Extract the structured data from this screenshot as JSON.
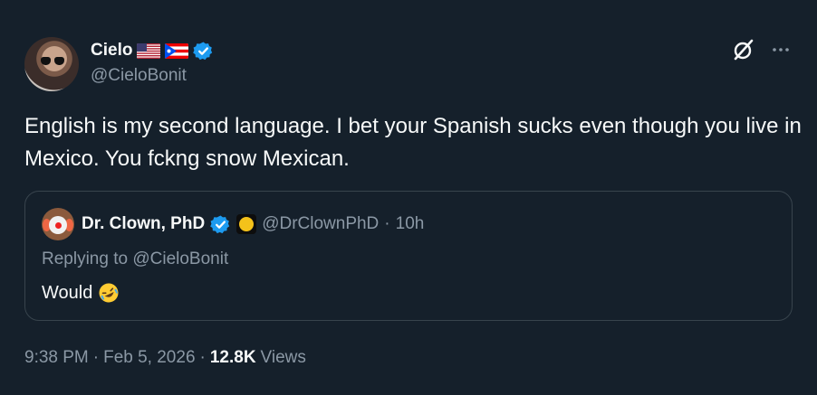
{
  "author": {
    "name": "Cielo",
    "handle": "@CieloBonit"
  },
  "tweet": {
    "text": "English is my second language. I bet your Spanish sucks even though you live in Mexico. You fckng snow Mexican."
  },
  "quoted_tweet": {
    "name": "Dr. Clown, PhD",
    "handle": "@DrClownPhD",
    "separator": "·",
    "time": "10h",
    "replying_prefix": "Replying to",
    "replying_handle": "@CieloBonit",
    "text": "Would"
  },
  "meta": {
    "time": "9:38 PM",
    "separator1": "·",
    "date": "Feb 5, 2026",
    "separator2": "·",
    "views_count": "12.8K",
    "views_label": "Views"
  },
  "icons": {
    "flags": [
      "us-flag-icon",
      "puerto-rico-flag-icon"
    ],
    "verified": "verified-badge-icon",
    "grok": "grok-icon",
    "more": "more-dots-icon",
    "emoji": "rolling-laughing-emoji-icon"
  },
  "colors": {
    "background": "#15202b",
    "text": "#f7f9f9",
    "secondary": "#8b98a5",
    "verified": "#1d9bf0",
    "border": "#38444d"
  }
}
